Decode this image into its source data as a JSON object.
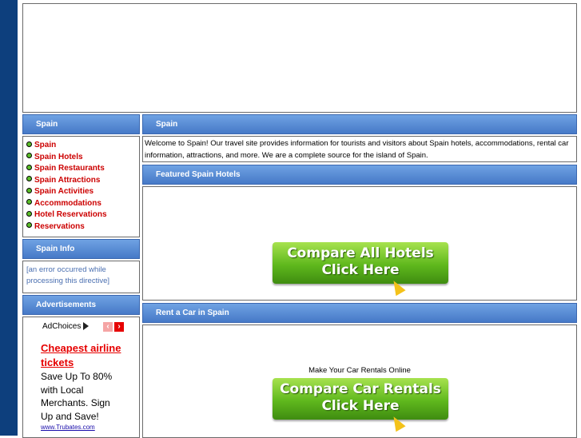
{
  "left_nav": {
    "header": "Spain",
    "items": [
      {
        "label": "Spain"
      },
      {
        "label": "Spain Hotels"
      },
      {
        "label": "Spain Restaurants"
      },
      {
        "label": "Spain Attractions"
      },
      {
        "label": "Spain Activities"
      },
      {
        "label": "Accommodations"
      },
      {
        "label": "Hotel Reservations"
      },
      {
        "label": "Reservations"
      }
    ]
  },
  "info": {
    "header": "Spain Info",
    "error_text": "[an error occurred while processing this directive]"
  },
  "ads": {
    "header": "Advertisements",
    "adchoices": "AdChoices",
    "title": "Cheapest airline tickets",
    "body": "Save Up To 80% with Local Merchants. Sign Up and Save!",
    "url": "www.Trubates.com"
  },
  "main": {
    "header": "Spain",
    "welcome": "Welcome to Spain!  Our travel site provides information for tourists and visitors about Spain hotels, accommodations, rental car information, attractions, and more.  We are a complete source for the island of Spain.",
    "featured_header": "Featured Spain Hotels",
    "hotels_cta_line1": "Compare All Hotels",
    "hotels_cta_line2": "Click Here",
    "rent_header": "Rent a Car in Spain",
    "rent_intro": "Make Your Car Rentals Online",
    "cars_cta_line1": "Compare Car Rentals",
    "cars_cta_line2": "Click Here"
  },
  "colors": {
    "header_blue": "#4679c7",
    "left_bar": "#0d3f7d",
    "link_red": "#cc0000",
    "cta_green": "#5fb81d"
  }
}
